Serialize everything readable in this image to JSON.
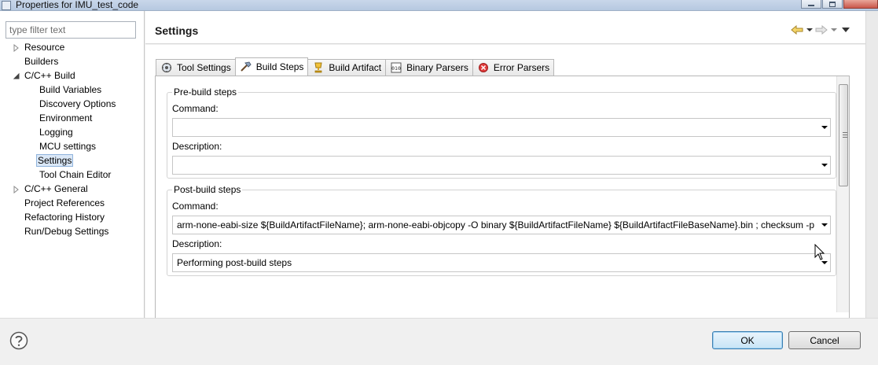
{
  "window": {
    "title": "Properties for IMU_test_code"
  },
  "sidebar": {
    "filter_placeholder": "type filter text",
    "items": [
      {
        "label": "Resource",
        "level": 0,
        "twisty": "collapsed"
      },
      {
        "label": "Builders",
        "level": 0,
        "twisty": "none"
      },
      {
        "label": "C/C++ Build",
        "level": 0,
        "twisty": "expanded"
      },
      {
        "label": "Build Variables",
        "level": 1,
        "twisty": "none"
      },
      {
        "label": "Discovery Options",
        "level": 1,
        "twisty": "none"
      },
      {
        "label": "Environment",
        "level": 1,
        "twisty": "none"
      },
      {
        "label": "Logging",
        "level": 1,
        "twisty": "none"
      },
      {
        "label": "MCU settings",
        "level": 1,
        "twisty": "none"
      },
      {
        "label": "Settings",
        "level": 1,
        "twisty": "none",
        "selected": true
      },
      {
        "label": "Tool Chain Editor",
        "level": 1,
        "twisty": "none"
      },
      {
        "label": "C/C++ General",
        "level": 0,
        "twisty": "collapsed"
      },
      {
        "label": "Project References",
        "level": 0,
        "twisty": "none"
      },
      {
        "label": "Refactoring History",
        "level": 0,
        "twisty": "none"
      },
      {
        "label": "Run/Debug Settings",
        "level": 0,
        "twisty": "none"
      }
    ]
  },
  "header": {
    "title": "Settings",
    "nav_icons": [
      "back-arrow-icon",
      "back-dropdown-icon",
      "forward-arrow-icon",
      "forward-dropdown-icon",
      "view-menu-icon"
    ]
  },
  "tabs": [
    {
      "label": "Tool Settings",
      "icon": "gear-icon",
      "active": false
    },
    {
      "label": "Build Steps",
      "icon": "hammer-icon",
      "active": true
    },
    {
      "label": "Build Artifact",
      "icon": "trophy-icon",
      "active": false
    },
    {
      "label": "Binary Parsers",
      "icon": "binary-icon",
      "active": false
    },
    {
      "label": "Error Parsers",
      "icon": "error-icon",
      "active": false
    }
  ],
  "prebuild": {
    "group_title": "Pre-build steps",
    "command_label": "Command:",
    "command_value": "",
    "description_label": "Description:",
    "description_value": ""
  },
  "postbuild": {
    "group_title": "Post-build steps",
    "command_label": "Command:",
    "command_value": "arm-none-eabi-size ${BuildArtifactFileName};  arm-none-eabi-objcopy -O binary ${BuildArtifactFileName} ${BuildArtifactFileBaseName}.bin ; checksum -p",
    "description_label": "Description:",
    "description_value": "Performing post-build steps"
  },
  "footer": {
    "ok_label": "OK",
    "cancel_label": "Cancel"
  },
  "colors": {
    "selection_bg": "#dbe8f7",
    "selection_border": "#8fb3dc",
    "default_button_border": "#3c7fb1"
  }
}
